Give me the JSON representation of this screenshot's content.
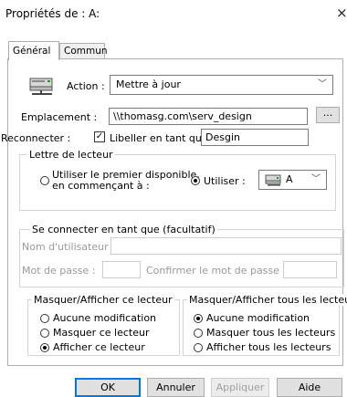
{
  "window": {
    "title": "Propriétés de : A:",
    "close_glyph": "×"
  },
  "tabs": [
    {
      "label": "Général",
      "active": true
    },
    {
      "label": "Commun",
      "active": false
    }
  ],
  "action": {
    "label": "Action :",
    "value": "Mettre à jour",
    "icon": "network-drive-icon"
  },
  "location": {
    "label": "Emplacement :",
    "value": "\\\\thomasg.com\\serv_design",
    "browse_label": "..."
  },
  "reconnect": {
    "label": "Reconnecter :",
    "checked": true,
    "check_glyph": "✓",
    "label_as": "Libeller en tant que :",
    "label_value": "Desgin"
  },
  "drive_letter": {
    "legend": "Lettre de lecteur",
    "first_available_line1": "Utiliser le premier disponible,",
    "first_available_line2": "en commençant à :",
    "use_label": "Utiliser :",
    "use_value": "A",
    "selected": "use"
  },
  "connect_as": {
    "legend": "Se connecter en tant que (facultatif)",
    "username_label": "Nom d'utilisateur :",
    "password_label": "Mot de passe :",
    "confirm_label": "Confirmer le mot de passe"
  },
  "hide_show_drive": {
    "legend": "Masquer/Afficher ce lecteur",
    "options": [
      "Aucune modification",
      "Masquer ce lecteur",
      "Afficher ce lecteur"
    ],
    "selected_index": 2
  },
  "hide_show_all": {
    "legend": "Masquer/Afficher tous les lecteurs",
    "options": [
      "Aucune modification",
      "Masquer tous les lecteurs",
      "Afficher tous les lecteurs"
    ],
    "selected_index": 0
  },
  "buttons": {
    "ok": "OK",
    "cancel": "Annuler",
    "apply": "Appliquer",
    "help": "Aide"
  }
}
